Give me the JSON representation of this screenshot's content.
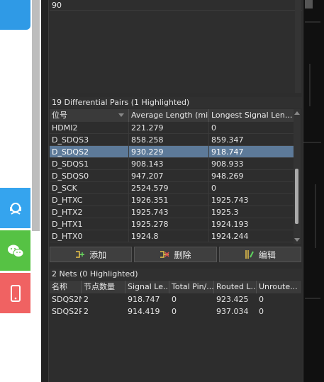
{
  "top_value": "90",
  "pairs_section": {
    "title": "19 Differential Pairs (1 Highlighted)",
    "columns": [
      "位号",
      "Average Length (mil)",
      "Longest Signal Len..."
    ],
    "rows": [
      [
        "HDMI2",
        "221.279",
        "0"
      ],
      [
        "D_SDQS3",
        "858.258",
        "859.347"
      ],
      [
        "D_SDQS2",
        "930.229",
        "918.747"
      ],
      [
        "D_SDQS1",
        "908.143",
        "908.933"
      ],
      [
        "D_SDQS0",
        "947.207",
        "948.269"
      ],
      [
        "D_SCK",
        "2524.579",
        "0"
      ],
      [
        "D_HTXC",
        "1926.351",
        "1925.743"
      ],
      [
        "D_HTX2",
        "1925.743",
        "1925.3"
      ],
      [
        "D_HTX1",
        "1925.278",
        "1924.193"
      ],
      [
        "D_HTX0",
        "1924.8",
        "1924.244"
      ]
    ],
    "highlighted_index": 2,
    "highlight_color": "#5d7a99"
  },
  "buttons": {
    "add": "添加",
    "delete": "删除",
    "edit": "编辑"
  },
  "nets_section": {
    "title": "2 Nets (0 Highlighted)",
    "columns": [
      "名称",
      "节点数量",
      "Signal Le...",
      "Total Pin/...",
      "Routed L...",
      "Unroute..."
    ],
    "rows": [
      [
        "SDQS2N",
        "2",
        "918.747",
        "0",
        "923.425",
        "0"
      ],
      [
        "SDQS2P",
        "2",
        "914.419",
        "0",
        "937.034",
        "0"
      ]
    ]
  },
  "side_icons": [
    "support-icon",
    "wechat-icon",
    "phone-icon"
  ]
}
